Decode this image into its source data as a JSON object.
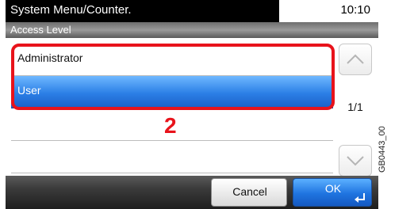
{
  "header": {
    "title": "System Menu/Counter.",
    "time": "10:10",
    "subtitle": "Access Level"
  },
  "list": {
    "items": [
      {
        "label": "Administrator",
        "selected": false
      },
      {
        "label": "User",
        "selected": true
      },
      {
        "label": ""
      },
      {
        "label": ""
      }
    ]
  },
  "pager": {
    "page": "1/1"
  },
  "callout": {
    "number": "2"
  },
  "footer": {
    "cancel_label": "Cancel",
    "ok_label": "OK"
  },
  "caption": "GB0443_00",
  "colors": {
    "selection": "#2b7fe6",
    "highlight": "#e8131b",
    "title_bar": "#000000"
  },
  "icons": {
    "scroll_up": "chevron-up-icon",
    "scroll_down": "chevron-down-icon",
    "enter": "enter-arrow-icon"
  }
}
